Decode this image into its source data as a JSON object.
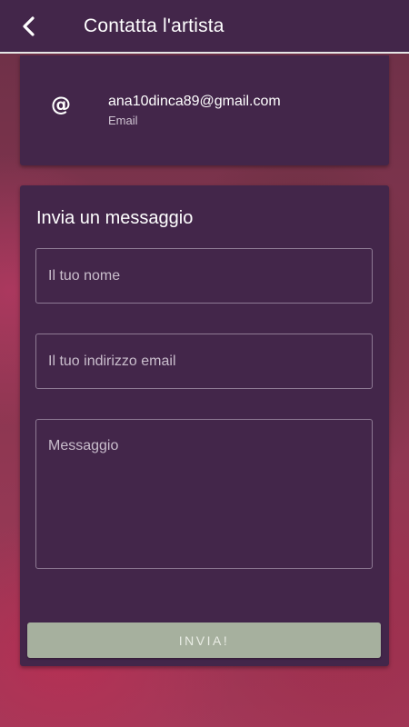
{
  "header": {
    "title": "Contatta l'artista",
    "back_icon": "chevron-left-icon"
  },
  "contact": {
    "icon": "at-icon",
    "icon_glyph": "@",
    "email": "ana10dinca89@gmail.com",
    "label": "Email"
  },
  "form": {
    "title": "Invia un messaggio",
    "name_placeholder": "Il tuo nome",
    "email_placeholder": "Il tuo indirizzo email",
    "message_placeholder": "Messaggio",
    "send_label": "INVIA!"
  },
  "colors": {
    "card": "#43264a",
    "button": "#a6b09e",
    "text": "#ffffff"
  }
}
